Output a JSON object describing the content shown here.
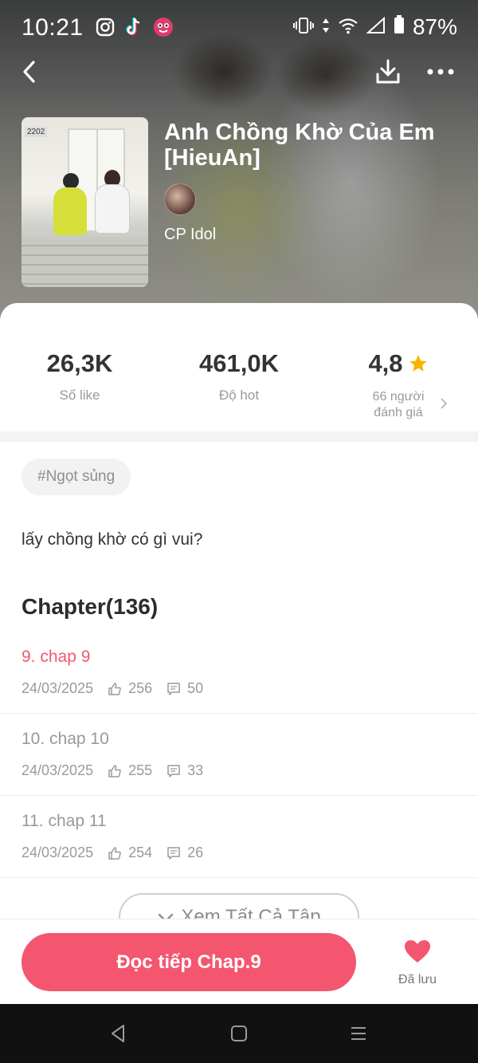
{
  "status_bar": {
    "time": "10:21",
    "battery": "87%"
  },
  "book": {
    "title": "Anh Chồng Khờ Của Em [HieuAn]",
    "author": "CP Idol",
    "cover_number": "2202"
  },
  "stats": {
    "likes_value": "26,3K",
    "likes_label": "Số like",
    "hot_value": "461,0K",
    "hot_label": "Độ hot",
    "rating_value": "4,8",
    "rating_count_label": "66 người đánh giá"
  },
  "tag": "#Ngọt sủng",
  "description": "lấy chồng khờ có gì vui?",
  "chapters": {
    "heading": "Chapter(136)",
    "items": [
      {
        "title": "9. chap 9",
        "date": "24/03/2025",
        "likes": "256",
        "comments": "50",
        "current": true
      },
      {
        "title": "10. chap 10",
        "date": "24/03/2025",
        "likes": "255",
        "comments": "33",
        "current": false
      },
      {
        "title": "11. chap 11",
        "date": "24/03/2025",
        "likes": "254",
        "comments": "26",
        "current": false
      }
    ],
    "see_all_label": "Xem Tất Cả Tập"
  },
  "actions": {
    "read_label": "Đọc tiếp Chap.9",
    "saved_label": "Đã lưu"
  },
  "colors": {
    "accent": "#f4566f",
    "star": "#f7b500",
    "current_chapter": "#ee5a72"
  }
}
